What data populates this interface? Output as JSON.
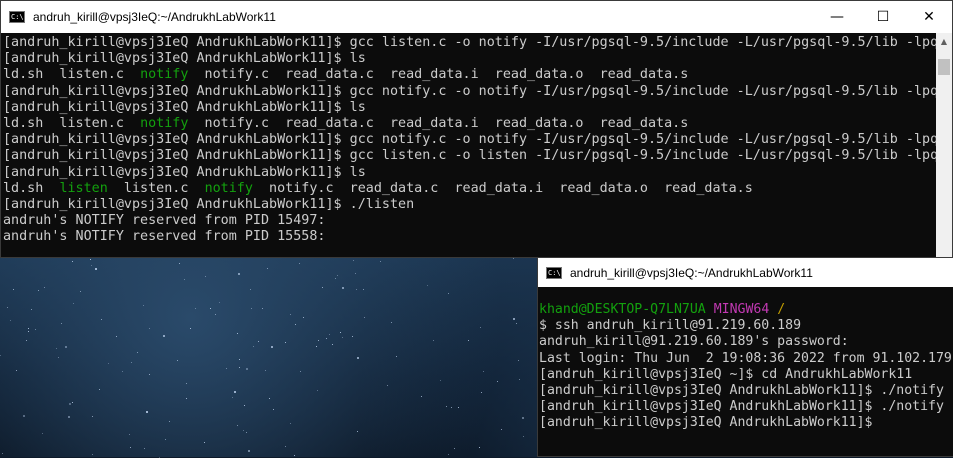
{
  "window1": {
    "title": "andruh_kirill@vpsj3IeQ:~/AndrukhLabWork11",
    "controls": {
      "minimize": "—",
      "maximize": "☐",
      "close": "✕"
    },
    "lines": [
      "[andruh_kirill@vpsj3IeQ AndrukhLabWork11]$ gcc listen.c -o notify -I/usr/pgsql-9.5/include -L/usr/pgsql-9.5/lib -lpq",
      "[andruh_kirill@vpsj3IeQ AndrukhLabWork11]$ ls",
      {
        "parts": [
          "ld.sh  listen.c  ",
          "notify",
          "  notify.c  read_data.c  read_data.i  read_data.o  read_data.s"
        ]
      },
      "[andruh_kirill@vpsj3IeQ AndrukhLabWork11]$ gcc notify.c -o notify -I/usr/pgsql-9.5/include -L/usr/pgsql-9.5/lib -lpq",
      "[andruh_kirill@vpsj3IeQ AndrukhLabWork11]$ ls",
      {
        "parts": [
          "ld.sh  listen.c  ",
          "notify",
          "  notify.c  read_data.c  read_data.i  read_data.o  read_data.s"
        ]
      },
      "[andruh_kirill@vpsj3IeQ AndrukhLabWork11]$ gcc notify.c -o notify -I/usr/pgsql-9.5/include -L/usr/pgsql-9.5/lib -lpq",
      "[andruh_kirill@vpsj3IeQ AndrukhLabWork11]$ gcc listen.c -o listen -I/usr/pgsql-9.5/include -L/usr/pgsql-9.5/lib -lpq",
      "[andruh_kirill@vpsj3IeQ AndrukhLabWork11]$ ls",
      {
        "parts": [
          "ld.sh  ",
          "listen",
          "  listen.c  ",
          "notify",
          "  notify.c  read_data.c  read_data.i  read_data.o  read_data.s"
        ]
      },
      "[andruh_kirill@vpsj3IeQ AndrukhLabWork11]$ ./listen",
      "andruh's NOTIFY reserved from PID 15497:",
      "andruh's NOTIFY reserved from PID 15558:"
    ],
    "colors": {
      "background": "#0c0c0c",
      "text": "#cccccc",
      "executable": "#13a10e"
    }
  },
  "window2": {
    "title": "andruh_kirill@vpsj3IeQ:~/AndrukhLabWork11",
    "prompt": {
      "user_host": "khand@DESKTOP-Q7LN7UA",
      "env": "MINGW64",
      "path": "/"
    },
    "lines": [
      "$ ssh andruh_kirill@91.219.60.189",
      "andruh_kirill@91.219.60.189's password:",
      "Last login: Thu Jun  2 19:08:36 2022 from 91.102.179",
      "[andruh_kirill@vpsj3IeQ ~]$ cd AndrukhLabWork11",
      "[andruh_kirill@vpsj3IeQ AndrukhLabWork11]$ ./notify",
      "[andruh_kirill@vpsj3IeQ AndrukhLabWork11]$ ./notify",
      "[andruh_kirill@vpsj3IeQ AndrukhLabWork11]$"
    ],
    "colors": {
      "user_host": "#13a10e",
      "env": "#c239b3",
      "path": "#c19c00"
    }
  },
  "icons": [
    "console-icon",
    "minimize-icon",
    "maximize-icon",
    "close-icon",
    "scroll-up-icon"
  ]
}
